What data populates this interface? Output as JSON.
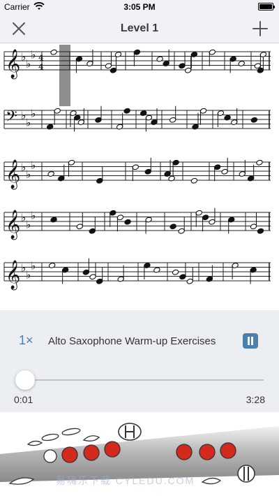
{
  "status_bar": {
    "carrier": "Carrier",
    "time": "3:05 PM",
    "wifi_icon": "wifi-icon",
    "battery_icon": "battery-icon"
  },
  "nav": {
    "title": "Level 1",
    "close_icon": "close-icon",
    "add_icon": "plus-icon"
  },
  "score": {
    "key_signature": "E-flat major (3 flats)",
    "time_signature": "4/4",
    "systems": 5
  },
  "player": {
    "speed_label": "1×",
    "track_title": "Alto Saxophone Warm-up Exercises",
    "pause_icon": "pause-icon",
    "current_time": "0:01",
    "total_time": "3:28",
    "progress": 0.005,
    "accent_color": "#4a7fb0"
  },
  "fingering": {
    "pressed_key_color": "#d42a1e",
    "watermark": "易嗨乐下载 CYLEDU.COM"
  }
}
